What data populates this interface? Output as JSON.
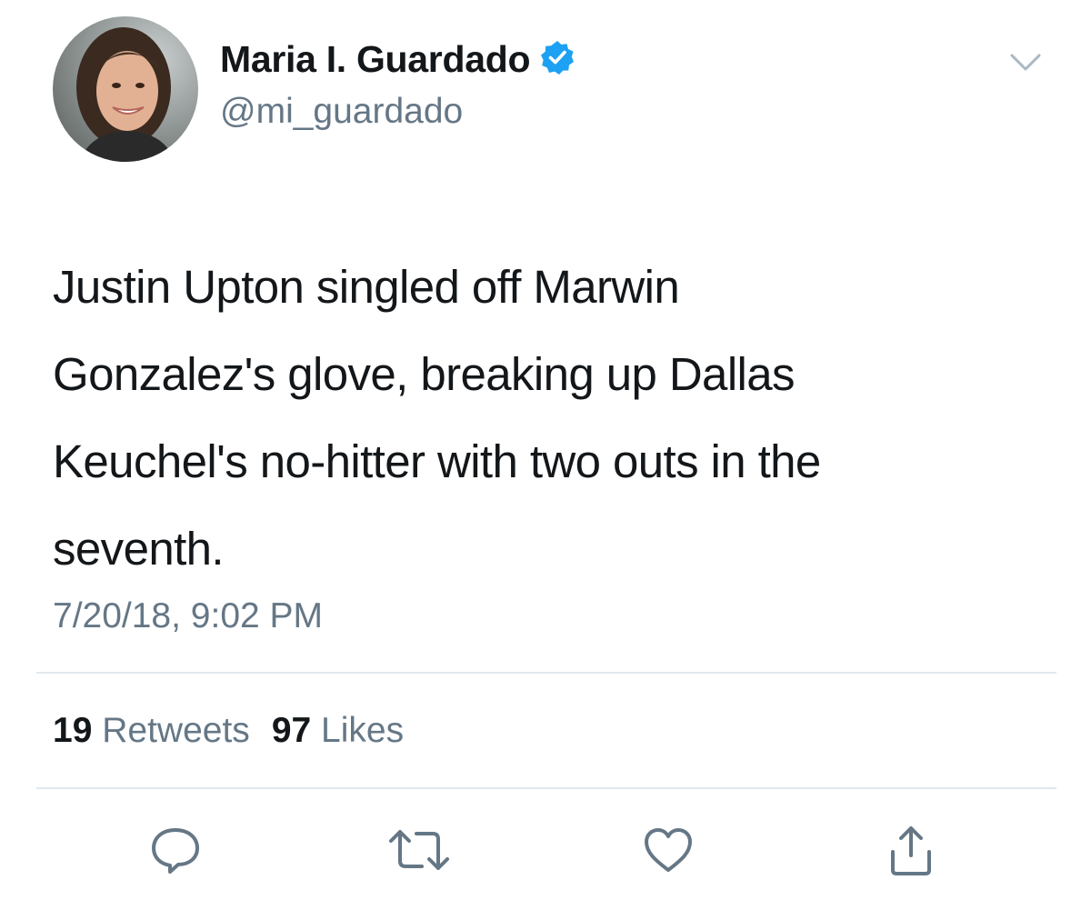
{
  "author": {
    "display_name": "Maria I. Guardado",
    "handle": "@mi_guardado",
    "verified_icon": "verified-badge-icon",
    "avatar_icon": "profile-photo"
  },
  "menu": {
    "icon": "chevron-down-icon"
  },
  "tweet": {
    "lines": [
      "Justin Upton singled off Marwin",
      "Gonzalez's glove, breaking up Dallas",
      "Keuchel's no-hitter with two outs in the",
      "seventh."
    ],
    "timestamp": "7/20/18, 9:02 PM"
  },
  "stats": {
    "retweets_count": "19",
    "retweets_label": "Retweets",
    "likes_count": "97",
    "likes_label": "Likes"
  },
  "actions": [
    {
      "icon": "reply-icon"
    },
    {
      "icon": "retweet-icon"
    },
    {
      "icon": "like-icon"
    },
    {
      "icon": "share-icon"
    }
  ],
  "colors": {
    "text_primary": "#14171a",
    "text_secondary": "#657786",
    "verified_blue": "#1da1f2",
    "divider": "#e1e8ed"
  }
}
